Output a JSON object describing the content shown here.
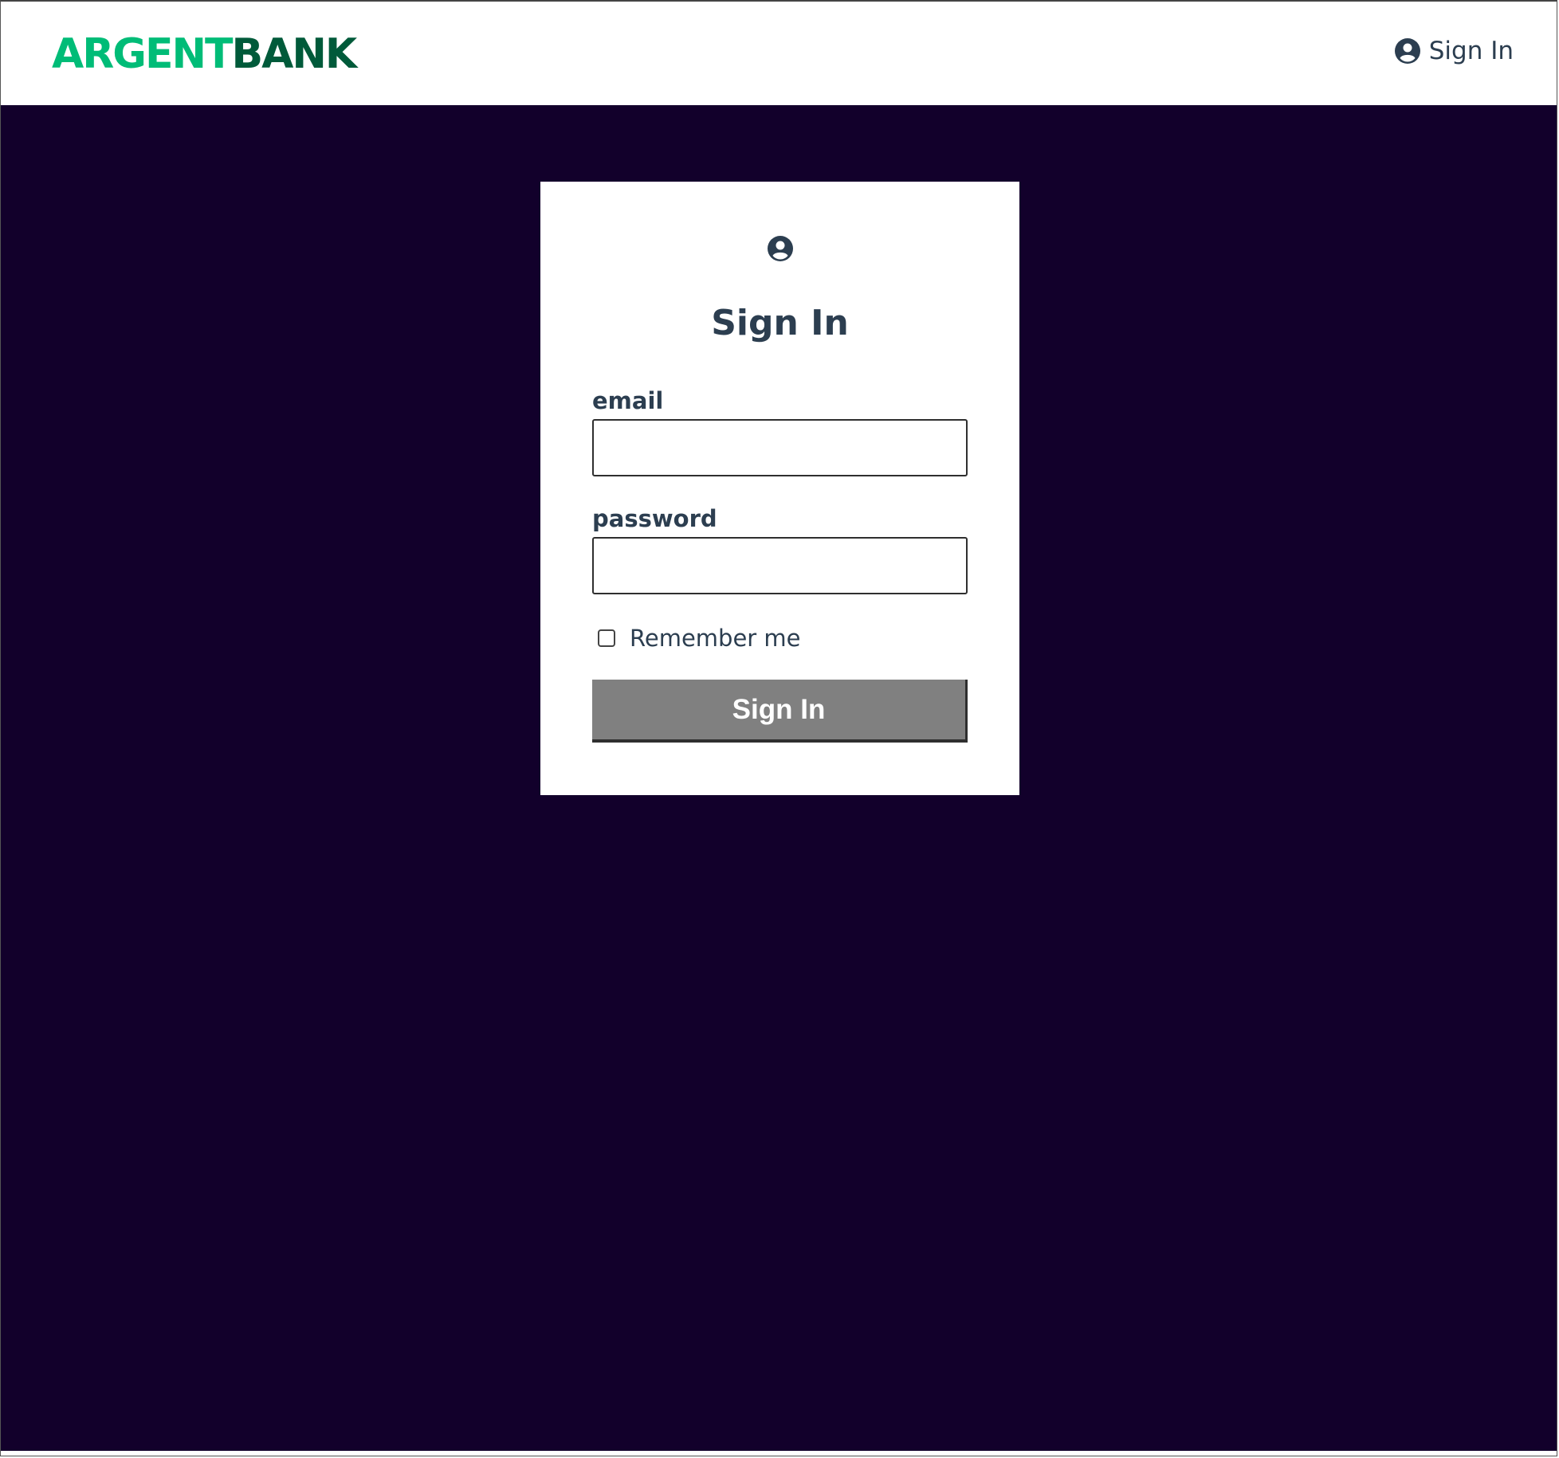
{
  "navbar": {
    "logo_part1": "ARGENT",
    "logo_part2": "BANK",
    "signin_icon": "user-circle-icon",
    "signin_label": "Sign In"
  },
  "login": {
    "icon": "user-circle-icon",
    "title": "Sign In",
    "email_label": "email",
    "email_value": "",
    "password_label": "password",
    "password_value": "",
    "remember_label": "Remember me",
    "remember_checked": false,
    "submit_label": "Sign In"
  },
  "colors": {
    "brand_green": "#00bc77",
    "brand_dark_green": "#005a3a",
    "background": "#12002b",
    "text": "#2c3e50",
    "button": "#808080"
  }
}
